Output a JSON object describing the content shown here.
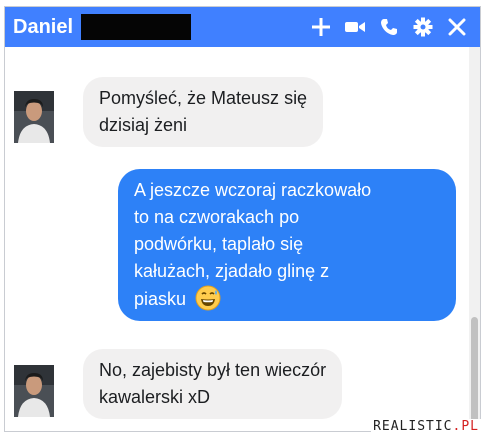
{
  "chat": {
    "contact_name": "Daniel",
    "header_actions": [
      {
        "icon": "plus-icon"
      },
      {
        "icon": "video-call-icon"
      },
      {
        "icon": "phone-icon"
      },
      {
        "icon": "gear-icon"
      },
      {
        "icon": "close-icon"
      }
    ],
    "messages": [
      {
        "direction": "incoming",
        "lines": [
          "Pomyśleć, że Mateusz się",
          "dzisiaj żeni"
        ]
      },
      {
        "direction": "outgoing",
        "lines": [
          "A jeszcze wczoraj raczkowało",
          "to na czworakach po",
          "podwórku, taplało się",
          "kałużach, zjadało glinę z",
          "piasku"
        ],
        "trailing_emoji": "grinning-sweat-emoji"
      },
      {
        "direction": "incoming",
        "lines": [
          "No, zajebisty był ten wieczór",
          "kawalerski xD"
        ]
      }
    ]
  },
  "watermark": {
    "main": "REALISTIC",
    "accent": ".PL"
  },
  "colors": {
    "header": "#4080ff",
    "outgoing_bubble": "#2d81f7",
    "incoming_bubble": "#f1f0f0"
  }
}
